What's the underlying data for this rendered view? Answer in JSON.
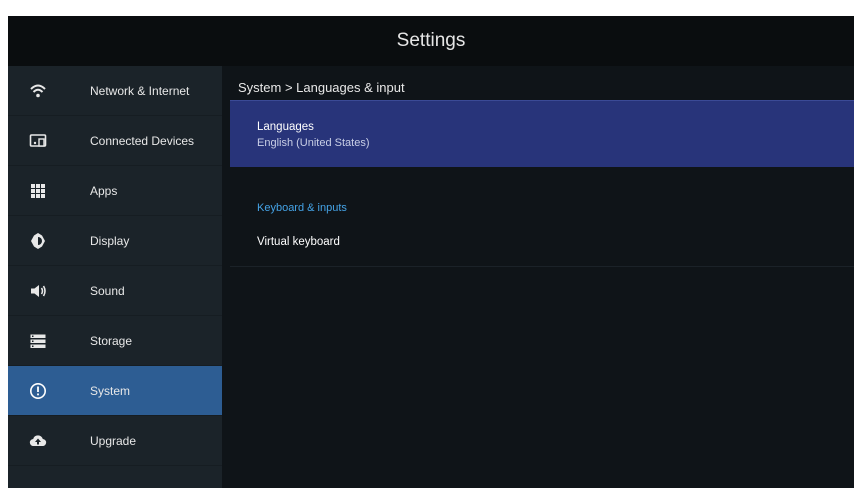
{
  "header": {
    "title": "Settings"
  },
  "sidebar": {
    "items": [
      {
        "label": "Network & Internet",
        "icon": "wifi-icon"
      },
      {
        "label": "Connected Devices",
        "icon": "devices-icon"
      },
      {
        "label": "Apps",
        "icon": "apps-grid-icon"
      },
      {
        "label": "Display",
        "icon": "brightness-icon"
      },
      {
        "label": "Sound",
        "icon": "volume-icon"
      },
      {
        "label": "Storage",
        "icon": "storage-icon"
      },
      {
        "label": "System",
        "icon": "info-icon",
        "active": true
      },
      {
        "label": "Upgrade",
        "icon": "cloud-upload-icon"
      }
    ]
  },
  "main": {
    "breadcrumb": "System > Languages & input",
    "languages": {
      "title": "Languages",
      "value": "English (United States)"
    },
    "section_header": "Keyboard & inputs",
    "virtual_keyboard": {
      "title": "Virtual keyboard"
    }
  },
  "colors": {
    "accent_selected": "#2d5d93",
    "highlight_row": "#28347a",
    "section_header": "#45a3e6"
  }
}
